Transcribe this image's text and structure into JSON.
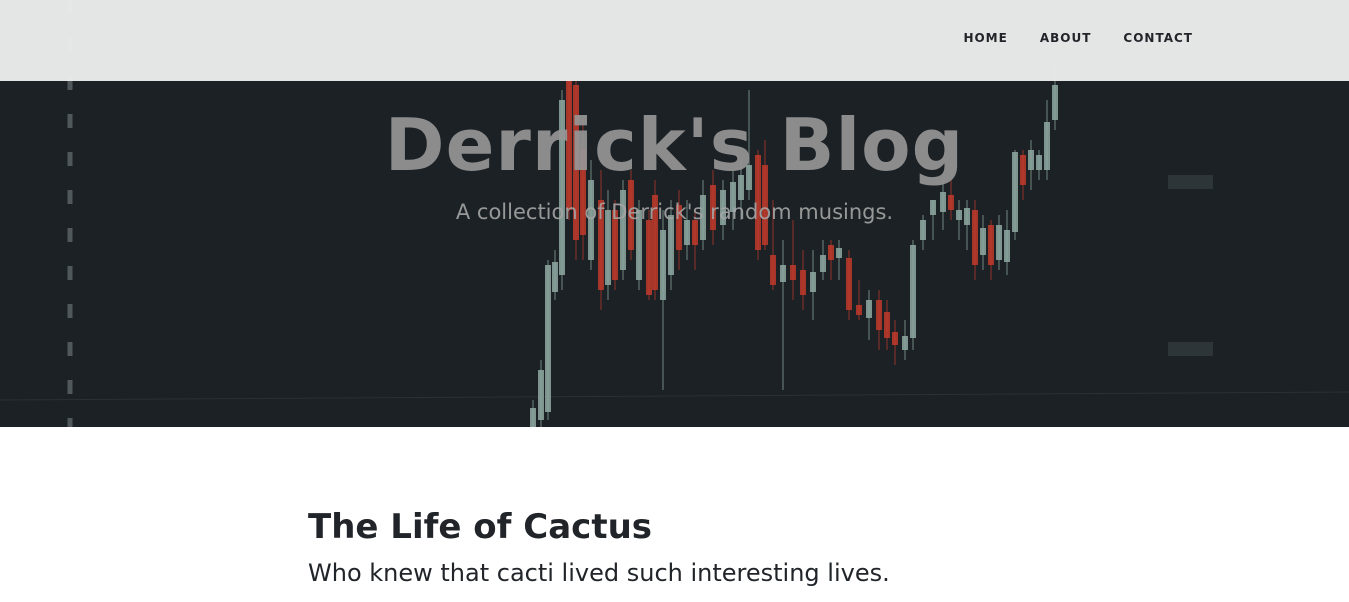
{
  "nav": {
    "items": [
      {
        "label": "HOME"
      },
      {
        "label": "ABOUT"
      },
      {
        "label": "CONTACT"
      }
    ]
  },
  "hero": {
    "title": "Derrick's Blog",
    "subtitle": "A collection of Derrick's random musings.",
    "background_image": "dark-candlestick-stock-chart",
    "colors": {
      "background": "#1b2125",
      "candle_up": "#8fa8a2",
      "candle_down": "#c0392b"
    }
  },
  "posts": [
    {
      "title": "The Life of Cactus",
      "subtitle": "Who knew that cacti lived such interesting lives."
    }
  ]
}
